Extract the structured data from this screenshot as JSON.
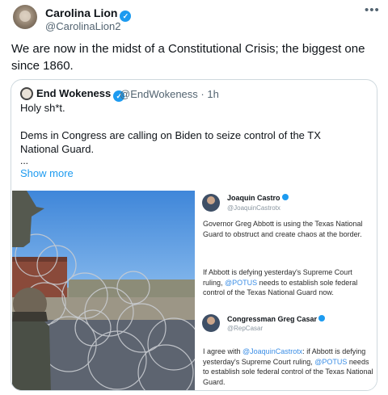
{
  "tweet": {
    "author_name": "Carolina Lion",
    "author_handle": "@CarolinaLion2",
    "more_icon": "more-horizontal-icon",
    "text": "We are now in the midst of a Constitutional Crisis; the biggest one since 1860."
  },
  "quote": {
    "author_name": "End Wokeness",
    "author_handle": "@EndWokeness · 1h",
    "line1": "Holy sh*t.",
    "line2": "Dems in Congress are calling on Biden to seize control of the TX National Guard.",
    "ellipsis": "...",
    "show_more": "Show more"
  },
  "screenshots": {
    "castro": {
      "name": "Joaquin Castro",
      "handle": "@JoaquinCastrotx",
      "p1": "Governor Greg Abbott is using the Texas National Guard to obstruct and create chaos at the border.",
      "p2_a": "If Abbott is defying yesterday's Supreme Court ruling, ",
      "p2_mention": "@POTUS",
      "p2_b": " needs to establish sole federal control of the Texas National Guard now."
    },
    "casar": {
      "name": "Congressman Greg Casar",
      "handle": "@RepCasar",
      "p1_a": "I agree with ",
      "p1_mention": "@JoaquinCastrotx",
      "p1_b": ": if Abbott is defying yesterday's Supreme Court ruling, ",
      "p1_mention2": "@POTUS",
      "p1_c": " needs to establish sole federal control of the Texas National Guard."
    }
  },
  "colors": {
    "accent": "#1d9bf0",
    "text_secondary": "#536471",
    "border": "#cfd9de"
  }
}
